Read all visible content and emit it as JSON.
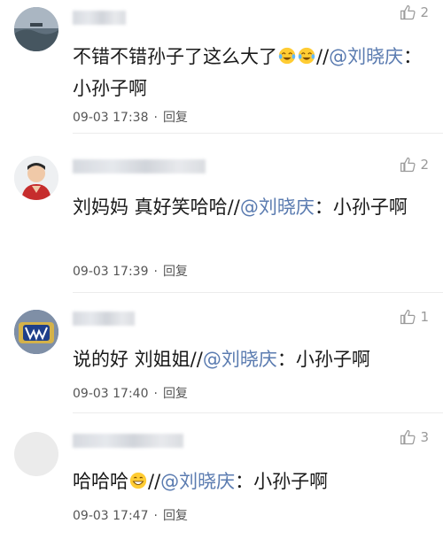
{
  "comments": [
    {
      "text_plain": "不错不错孙子了这么大了",
      "text_after_emoji": "//",
      "mention": "@刘晓庆",
      "text_tail": "：小孙子啊",
      "time": "09-03 17:38",
      "reply_label": "回复",
      "likes": "2",
      "emoji_count": 2
    },
    {
      "text_plain": "刘妈妈 真好笑哈哈//",
      "mention": "@刘晓庆",
      "text_tail": "：小孙子啊",
      "time": "09-03 17:39",
      "reply_label": "回复",
      "likes": "2"
    },
    {
      "text_plain": "说的好 刘姐姐//",
      "mention": "@刘晓庆",
      "text_tail": "：小孙子啊",
      "time": "09-03 17:40",
      "reply_label": "回复",
      "likes": "1"
    },
    {
      "text_plain": "哈哈哈",
      "text_after_emoji": "//",
      "mention": "@刘晓庆",
      "text_tail": "：小孙子啊",
      "time": "09-03 17:47",
      "reply_label": "回复",
      "likes": "3",
      "emoji_count": 1
    }
  ],
  "colors": {
    "mention": "#5a7bb0",
    "text": "#1a1a1a",
    "meta": "#555555",
    "like": "#9a9a9a"
  },
  "icons": {
    "like": "thumbs-up-icon",
    "emoji_first": "laughing-crying-face-icon",
    "emoji_last": "grinning-face-icon"
  },
  "separator_dot": "·"
}
